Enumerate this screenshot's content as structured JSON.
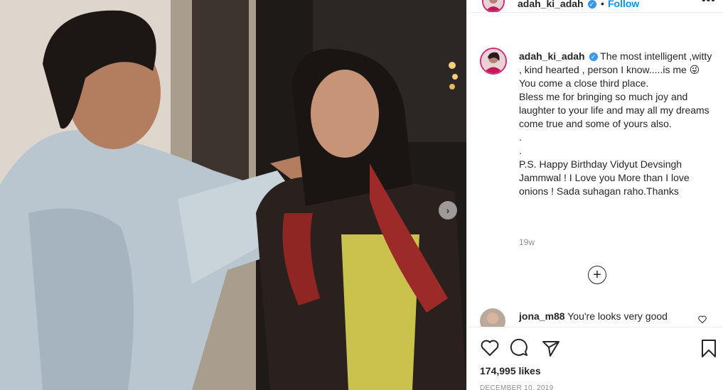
{
  "post": {
    "image": {
      "alt": "",
      "carousel_next_icon": "chevron-right-icon"
    },
    "header": {
      "username": "adah_ki_adah",
      "verified_icon": "verified-badge-icon",
      "separator": "•",
      "follow_label": "Follow",
      "more_icon": "more-options-icon",
      "more_label": "•••"
    },
    "caption": {
      "username": "adah_ki_adah",
      "lines": [
        "The most intelligent ,witty , kind hearted , person I know.....is me 😜",
        "You come a close third place.",
        "Bless me for bringing so much joy and laughter to your life and may all my dreams come true and some of yours also.",
        ".",
        ".",
        "P.S. Happy Birthday Vidyut Devsingh Jammwal ! I Love you More than I love onions ! Sada suhagan raho.Thanks"
      ],
      "age": "19w"
    },
    "load_more": {
      "icon": "plus-circle-icon",
      "label": "+"
    },
    "comments": [
      {
        "username": "jona_m88",
        "text": "You're looks very good",
        "like_icon": "heart-outline-icon"
      }
    ],
    "actions": {
      "like_icon": "heart-icon",
      "comment_icon": "comment-icon",
      "share_icon": "share-icon",
      "save_icon": "bookmark-icon"
    },
    "likes": "174,995 likes",
    "date": "DECEMBER 10, 2019"
  },
  "colors": {
    "link_blue": "#0095f6",
    "verified_blue": "#3897f0",
    "muted_gray": "#8e8e8e",
    "text": "#262626",
    "border": "#efefef"
  }
}
